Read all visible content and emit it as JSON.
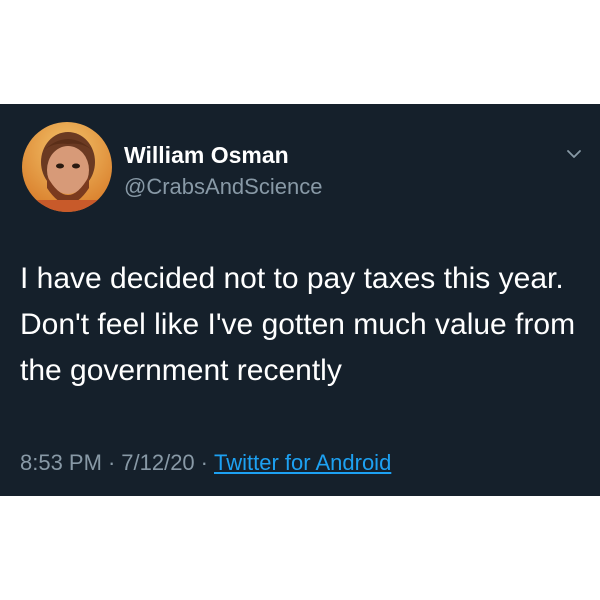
{
  "tweet": {
    "author": {
      "display_name": "William Osman",
      "handle": "@CrabsAndScience",
      "avatar_icon": "user-avatar"
    },
    "menu_icon": "chevron-down-icon",
    "text": "I have decided not to pay taxes this year. Don't feel like I've gotten much value from the government recently",
    "time": "8:53 PM",
    "separator": "·",
    "date": "7/12/20",
    "source": "Twitter for Android"
  },
  "colors": {
    "card_background": "#15202b",
    "primary_text": "#ffffff",
    "secondary_text": "#8899a6",
    "link": "#1da1f2"
  }
}
